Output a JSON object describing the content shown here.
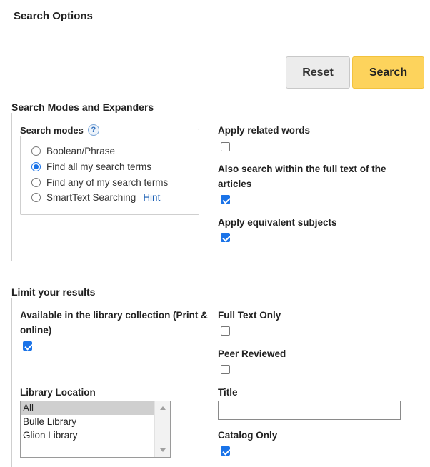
{
  "header": {
    "title": "Search Options"
  },
  "actions": {
    "reset_label": "Reset",
    "search_label": "Search"
  },
  "modes_section": {
    "legend": "Search Modes and Expanders",
    "search_modes": {
      "legend": "Search modes",
      "help_glyph": "?",
      "options": [
        {
          "label": "Boolean/Phrase",
          "checked": false
        },
        {
          "label": "Find all my search terms",
          "checked": true
        },
        {
          "label": "Find any of my search terms",
          "checked": false
        },
        {
          "label": "SmartText Searching",
          "checked": false,
          "link": "Hint"
        }
      ]
    },
    "expanders": [
      {
        "label": "Apply related words",
        "checked": false
      },
      {
        "label_line1": "Also search within the full text of the",
        "label_line2": "articles",
        "checked": true
      },
      {
        "label": "Apply equivalent subjects",
        "checked": true
      }
    ]
  },
  "limit_section": {
    "legend": "Limit your results",
    "available": {
      "label_line1": "Available in the library collection (Print &",
      "label_line2": "online)",
      "checked": true
    },
    "full_text": {
      "label": "Full Text Only",
      "checked": false
    },
    "peer_reviewed": {
      "label": "Peer Reviewed",
      "checked": false
    },
    "library_location": {
      "label": "Library Location",
      "options": [
        "All",
        "Bulle Library",
        "Glion Library"
      ],
      "selected": "All"
    },
    "title_field": {
      "label": "Title",
      "value": ""
    },
    "catalog_only": {
      "label": "Catalog Only",
      "checked": true
    }
  },
  "colors": {
    "accent": "#1a73e8",
    "search_button": "#fdd35c",
    "link": "#1a5fb4"
  }
}
